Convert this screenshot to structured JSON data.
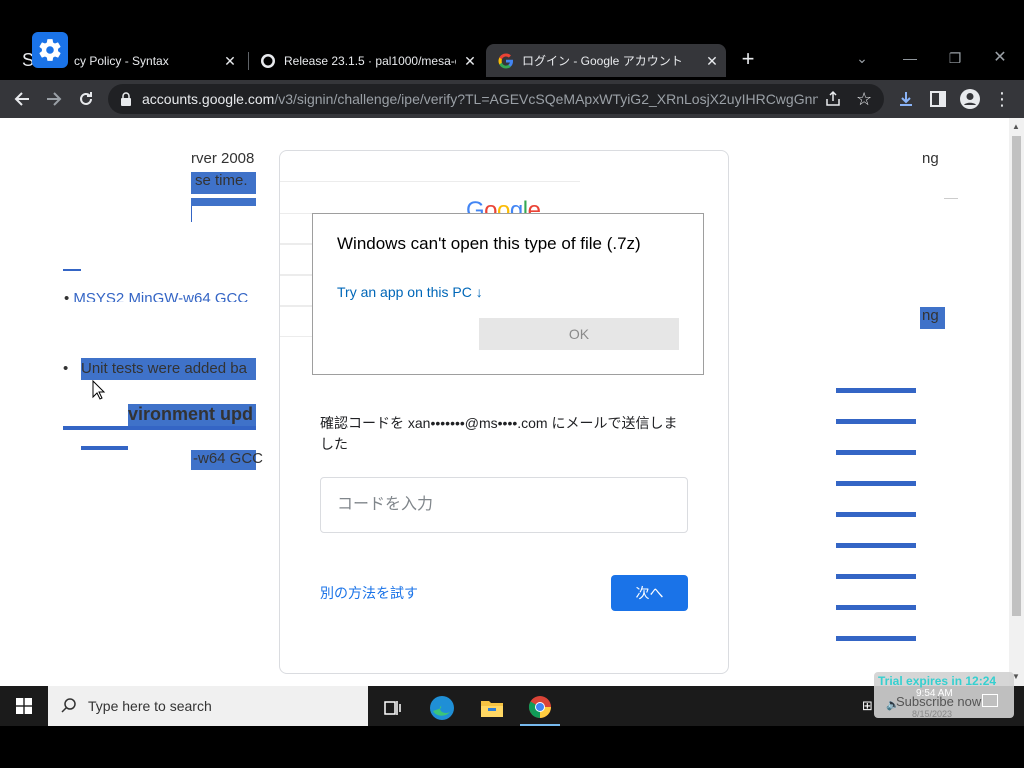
{
  "browser": {
    "tabs": [
      {
        "title": "cy Policy - Syntax",
        "active": false
      },
      {
        "title": "Release 23.1.5 · pal1000/mesa-di",
        "active": false
      },
      {
        "title": "ログイン - Google アカウント",
        "active": true
      }
    ],
    "tab_prefix_letter": "S",
    "new_tab_symbol": "+",
    "url_host": "accounts.google.com",
    "url_path": "/v3/signin/challenge/ipe/verify?TL=AGEVcSQeMApxWTyiG2_XRnLosjX2uyIHRCwgGnn...",
    "icons": [
      "back-icon",
      "forward-icon",
      "reload-icon",
      "lock-icon",
      "share-icon",
      "star-icon",
      "download-icon",
      "sidepanel-icon",
      "profile-icon",
      "menu-icon"
    ]
  },
  "background_page": {
    "fragments": {
      "server": "rver 2008",
      "release_time": "se time.",
      "mingw": "MSYS2 MinGW-w64 GCC",
      "unit_tests": "Unit tests were added ba",
      "environment": "vironment upd",
      "w64gcc": "-w64 GCC",
      "ng_top": "ng",
      "ng_mid": "ng"
    }
  },
  "google_card": {
    "logo": "Google",
    "verify_message": "確認コードを xan•••••••@ms••••.com にメールで送信しました",
    "code_placeholder": "コードを入力",
    "try_other": "別の方法を試す",
    "next": "次へ",
    "accent_color": "#1a73e8"
  },
  "dialog": {
    "title": "Windows can't open this type of file (.7z)",
    "link": "Try an app on this PC ↓",
    "ok": "OK"
  },
  "taskbar": {
    "search_placeholder": "Type here to search",
    "trial": "Trial expires in 12:24",
    "subscribe": "Subscribe now",
    "time": "9:54 AM",
    "date": "8/15/2023",
    "apps": [
      "task-view",
      "edge",
      "file-explorer",
      "chrome"
    ]
  }
}
